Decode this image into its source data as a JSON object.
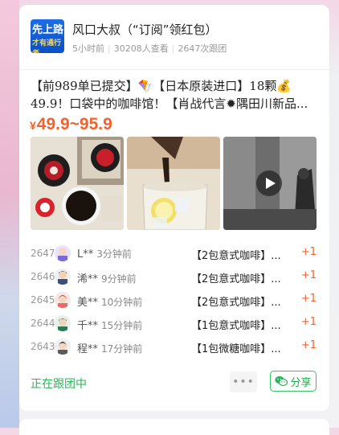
{
  "group": {
    "avatar_text_top": "先上路",
    "avatar_text_bottom": "才有通行者",
    "name": "风口大叔（“订阅”领红包）",
    "posted": "5小时前",
    "views": "30208人查看",
    "followers": "2647次跟团"
  },
  "post": {
    "description": "【前989单已提交】🪁【日本原装进口】18颗💰49.9！口袋中的咖啡馆！【肖战代言✹隅田川新品...",
    "price_symbol": "¥",
    "price_range": "49.9~95.9",
    "images": [
      "coffee-pods-image",
      "iced-coffee-image",
      "video-thumbnail"
    ]
  },
  "orders": [
    {
      "num": "2647",
      "name": "L**",
      "time": "3分钟前",
      "item": "【2包意式咖啡】...",
      "qty": "+1"
    },
    {
      "num": "2646",
      "name": "浠**",
      "time": "9分钟前",
      "item": "【2包意式咖啡】...",
      "qty": "+1"
    },
    {
      "num": "2645",
      "name": "美**",
      "time": "10分钟前",
      "item": "【2包意式咖啡】...",
      "qty": "+1"
    },
    {
      "num": "2644",
      "name": "千**",
      "time": "15分钟前",
      "item": "【1包意式咖啡】...",
      "qty": "+1"
    },
    {
      "num": "2643",
      "name": "程**",
      "time": "17分钟前",
      "item": "【1包微糖咖啡】...",
      "qty": "+1"
    }
  ],
  "footer": {
    "status": "正在跟团中",
    "more": "•••",
    "share": "分享"
  },
  "colors": {
    "accent": "#f0632f",
    "green": "#2bb35a"
  }
}
